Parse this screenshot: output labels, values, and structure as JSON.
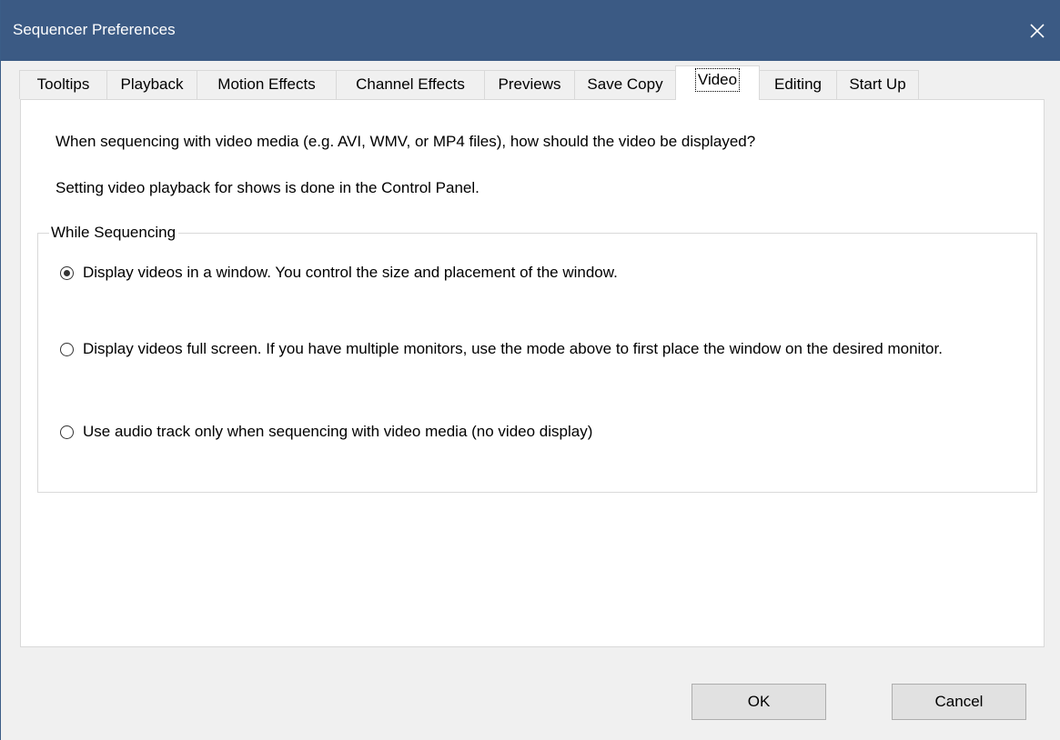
{
  "window": {
    "title": "Sequencer Preferences",
    "close_icon": "close-icon"
  },
  "tabs": [
    {
      "label": "Tooltips",
      "active": false
    },
    {
      "label": "Playback",
      "active": false
    },
    {
      "label": "Motion Effects",
      "active": false
    },
    {
      "label": "Channel Effects",
      "active": false
    },
    {
      "label": "Previews",
      "active": false
    },
    {
      "label": "Save Copy",
      "active": false
    },
    {
      "label": "Video",
      "active": true
    },
    {
      "label": "Editing",
      "active": false
    },
    {
      "label": "Start Up",
      "active": false
    }
  ],
  "video": {
    "description1": "When sequencing with video media (e.g. AVI, WMV, or MP4 files), how should the video be displayed?",
    "description2": "Setting video playback for shows is done in the Control Panel.",
    "group_title": "While Sequencing",
    "options": [
      {
        "label": "Display videos in a window. You control the size and placement of the window.",
        "selected": true
      },
      {
        "label": "Display videos full screen. If you have multiple monitors, use the mode above to first place the window on the desired monitor.",
        "selected": false
      },
      {
        "label": "Use audio track only when sequencing with video media (no video display)",
        "selected": false
      }
    ]
  },
  "buttons": {
    "ok_label": "OK",
    "cancel_label": "Cancel"
  }
}
